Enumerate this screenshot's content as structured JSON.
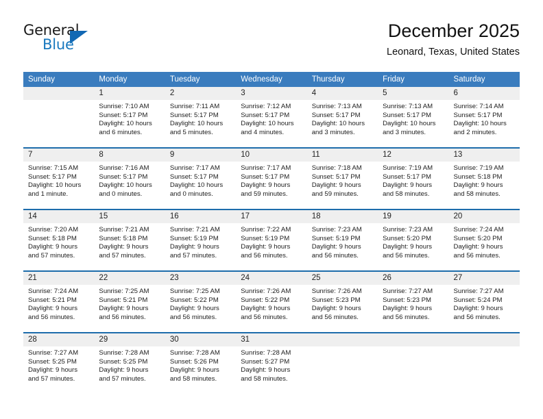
{
  "brand": {
    "line1": "General",
    "line2": "Blue",
    "triangle_color": "#1268b3",
    "blue_text_color": "#1878be"
  },
  "header": {
    "month_title": "December 2025",
    "location": "Leonard, Texas, United States"
  },
  "theme": {
    "header_row_bg": "#3a7cbe",
    "row_separator": "#1d6cab",
    "daynum_bg": "#efefef"
  },
  "weekday_headers": [
    "Sunday",
    "Monday",
    "Tuesday",
    "Wednesday",
    "Thursday",
    "Friday",
    "Saturday"
  ],
  "weeks": [
    {
      "cells": [
        {
          "day": "",
          "sunrise": "",
          "sunset": "",
          "daylight1": "",
          "daylight2": "",
          "empty": true
        },
        {
          "day": "1",
          "sunrise": "Sunrise: 7:10 AM",
          "sunset": "Sunset: 5:17 PM",
          "daylight1": "Daylight: 10 hours",
          "daylight2": "and 6 minutes."
        },
        {
          "day": "2",
          "sunrise": "Sunrise: 7:11 AM",
          "sunset": "Sunset: 5:17 PM",
          "daylight1": "Daylight: 10 hours",
          "daylight2": "and 5 minutes."
        },
        {
          "day": "3",
          "sunrise": "Sunrise: 7:12 AM",
          "sunset": "Sunset: 5:17 PM",
          "daylight1": "Daylight: 10 hours",
          "daylight2": "and 4 minutes."
        },
        {
          "day": "4",
          "sunrise": "Sunrise: 7:13 AM",
          "sunset": "Sunset: 5:17 PM",
          "daylight1": "Daylight: 10 hours",
          "daylight2": "and 3 minutes."
        },
        {
          "day": "5",
          "sunrise": "Sunrise: 7:13 AM",
          "sunset": "Sunset: 5:17 PM",
          "daylight1": "Daylight: 10 hours",
          "daylight2": "and 3 minutes."
        },
        {
          "day": "6",
          "sunrise": "Sunrise: 7:14 AM",
          "sunset": "Sunset: 5:17 PM",
          "daylight1": "Daylight: 10 hours",
          "daylight2": "and 2 minutes."
        }
      ]
    },
    {
      "cells": [
        {
          "day": "7",
          "sunrise": "Sunrise: 7:15 AM",
          "sunset": "Sunset: 5:17 PM",
          "daylight1": "Daylight: 10 hours",
          "daylight2": "and 1 minute."
        },
        {
          "day": "8",
          "sunrise": "Sunrise: 7:16 AM",
          "sunset": "Sunset: 5:17 PM",
          "daylight1": "Daylight: 10 hours",
          "daylight2": "and 0 minutes."
        },
        {
          "day": "9",
          "sunrise": "Sunrise: 7:17 AM",
          "sunset": "Sunset: 5:17 PM",
          "daylight1": "Daylight: 10 hours",
          "daylight2": "and 0 minutes."
        },
        {
          "day": "10",
          "sunrise": "Sunrise: 7:17 AM",
          "sunset": "Sunset: 5:17 PM",
          "daylight1": "Daylight: 9 hours",
          "daylight2": "and 59 minutes."
        },
        {
          "day": "11",
          "sunrise": "Sunrise: 7:18 AM",
          "sunset": "Sunset: 5:17 PM",
          "daylight1": "Daylight: 9 hours",
          "daylight2": "and 59 minutes."
        },
        {
          "day": "12",
          "sunrise": "Sunrise: 7:19 AM",
          "sunset": "Sunset: 5:17 PM",
          "daylight1": "Daylight: 9 hours",
          "daylight2": "and 58 minutes."
        },
        {
          "day": "13",
          "sunrise": "Sunrise: 7:19 AM",
          "sunset": "Sunset: 5:18 PM",
          "daylight1": "Daylight: 9 hours",
          "daylight2": "and 58 minutes."
        }
      ]
    },
    {
      "cells": [
        {
          "day": "14",
          "sunrise": "Sunrise: 7:20 AM",
          "sunset": "Sunset: 5:18 PM",
          "daylight1": "Daylight: 9 hours",
          "daylight2": "and 57 minutes."
        },
        {
          "day": "15",
          "sunrise": "Sunrise: 7:21 AM",
          "sunset": "Sunset: 5:18 PM",
          "daylight1": "Daylight: 9 hours",
          "daylight2": "and 57 minutes."
        },
        {
          "day": "16",
          "sunrise": "Sunrise: 7:21 AM",
          "sunset": "Sunset: 5:19 PM",
          "daylight1": "Daylight: 9 hours",
          "daylight2": "and 57 minutes."
        },
        {
          "day": "17",
          "sunrise": "Sunrise: 7:22 AM",
          "sunset": "Sunset: 5:19 PM",
          "daylight1": "Daylight: 9 hours",
          "daylight2": "and 56 minutes."
        },
        {
          "day": "18",
          "sunrise": "Sunrise: 7:23 AM",
          "sunset": "Sunset: 5:19 PM",
          "daylight1": "Daylight: 9 hours",
          "daylight2": "and 56 minutes."
        },
        {
          "day": "19",
          "sunrise": "Sunrise: 7:23 AM",
          "sunset": "Sunset: 5:20 PM",
          "daylight1": "Daylight: 9 hours",
          "daylight2": "and 56 minutes."
        },
        {
          "day": "20",
          "sunrise": "Sunrise: 7:24 AM",
          "sunset": "Sunset: 5:20 PM",
          "daylight1": "Daylight: 9 hours",
          "daylight2": "and 56 minutes."
        }
      ]
    },
    {
      "cells": [
        {
          "day": "21",
          "sunrise": "Sunrise: 7:24 AM",
          "sunset": "Sunset: 5:21 PM",
          "daylight1": "Daylight: 9 hours",
          "daylight2": "and 56 minutes."
        },
        {
          "day": "22",
          "sunrise": "Sunrise: 7:25 AM",
          "sunset": "Sunset: 5:21 PM",
          "daylight1": "Daylight: 9 hours",
          "daylight2": "and 56 minutes."
        },
        {
          "day": "23",
          "sunrise": "Sunrise: 7:25 AM",
          "sunset": "Sunset: 5:22 PM",
          "daylight1": "Daylight: 9 hours",
          "daylight2": "and 56 minutes."
        },
        {
          "day": "24",
          "sunrise": "Sunrise: 7:26 AM",
          "sunset": "Sunset: 5:22 PM",
          "daylight1": "Daylight: 9 hours",
          "daylight2": "and 56 minutes."
        },
        {
          "day": "25",
          "sunrise": "Sunrise: 7:26 AM",
          "sunset": "Sunset: 5:23 PM",
          "daylight1": "Daylight: 9 hours",
          "daylight2": "and 56 minutes."
        },
        {
          "day": "26",
          "sunrise": "Sunrise: 7:27 AM",
          "sunset": "Sunset: 5:23 PM",
          "daylight1": "Daylight: 9 hours",
          "daylight2": "and 56 minutes."
        },
        {
          "day": "27",
          "sunrise": "Sunrise: 7:27 AM",
          "sunset": "Sunset: 5:24 PM",
          "daylight1": "Daylight: 9 hours",
          "daylight2": "and 56 minutes."
        }
      ]
    },
    {
      "cells": [
        {
          "day": "28",
          "sunrise": "Sunrise: 7:27 AM",
          "sunset": "Sunset: 5:25 PM",
          "daylight1": "Daylight: 9 hours",
          "daylight2": "and 57 minutes."
        },
        {
          "day": "29",
          "sunrise": "Sunrise: 7:28 AM",
          "sunset": "Sunset: 5:25 PM",
          "daylight1": "Daylight: 9 hours",
          "daylight2": "and 57 minutes."
        },
        {
          "day": "30",
          "sunrise": "Sunrise: 7:28 AM",
          "sunset": "Sunset: 5:26 PM",
          "daylight1": "Daylight: 9 hours",
          "daylight2": "and 58 minutes."
        },
        {
          "day": "31",
          "sunrise": "Sunrise: 7:28 AM",
          "sunset": "Sunset: 5:27 PM",
          "daylight1": "Daylight: 9 hours",
          "daylight2": "and 58 minutes."
        },
        {
          "day": "",
          "sunrise": "",
          "sunset": "",
          "daylight1": "",
          "daylight2": "",
          "empty": true
        },
        {
          "day": "",
          "sunrise": "",
          "sunset": "",
          "daylight1": "",
          "daylight2": "",
          "empty": true
        },
        {
          "day": "",
          "sunrise": "",
          "sunset": "",
          "daylight1": "",
          "daylight2": "",
          "empty": true
        }
      ]
    }
  ]
}
